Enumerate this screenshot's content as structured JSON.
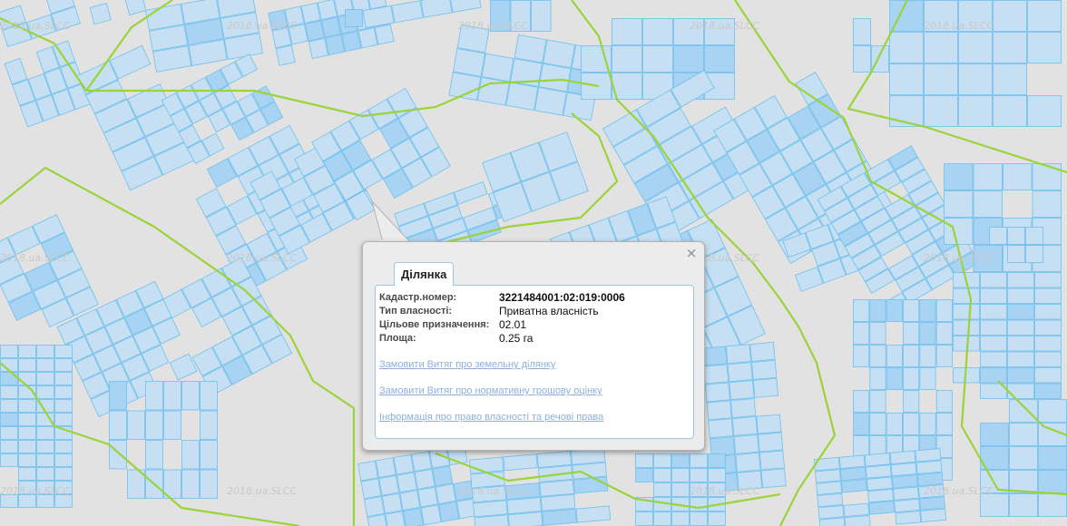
{
  "map": {
    "watermark": "2018.ua.SLCC",
    "colors": {
      "background": "#e2e2e2",
      "parcel_fill": "#c6dff2",
      "parcel_fill_dark": "#a9d3f2",
      "parcel_stroke": "#6ec0ee",
      "boundary_line": "#9bd33a"
    }
  },
  "popup": {
    "tab_label": "Ділянка",
    "close_glyph": "×",
    "fields": [
      {
        "label": "Кадастр.номер:",
        "value": "3221484001:02:019:0006"
      },
      {
        "label": "Тип власності:",
        "value": "Приватна власність"
      },
      {
        "label": "Цільове призначення:",
        "value": "02.01"
      },
      {
        "label": "Площа:",
        "value": "0.25 га"
      }
    ],
    "links": [
      "Замовити Витяг про земельну ділянку",
      "Замовити Витяг про нормативну грошову оцінку",
      "Інформація про право власності та речові права"
    ]
  }
}
